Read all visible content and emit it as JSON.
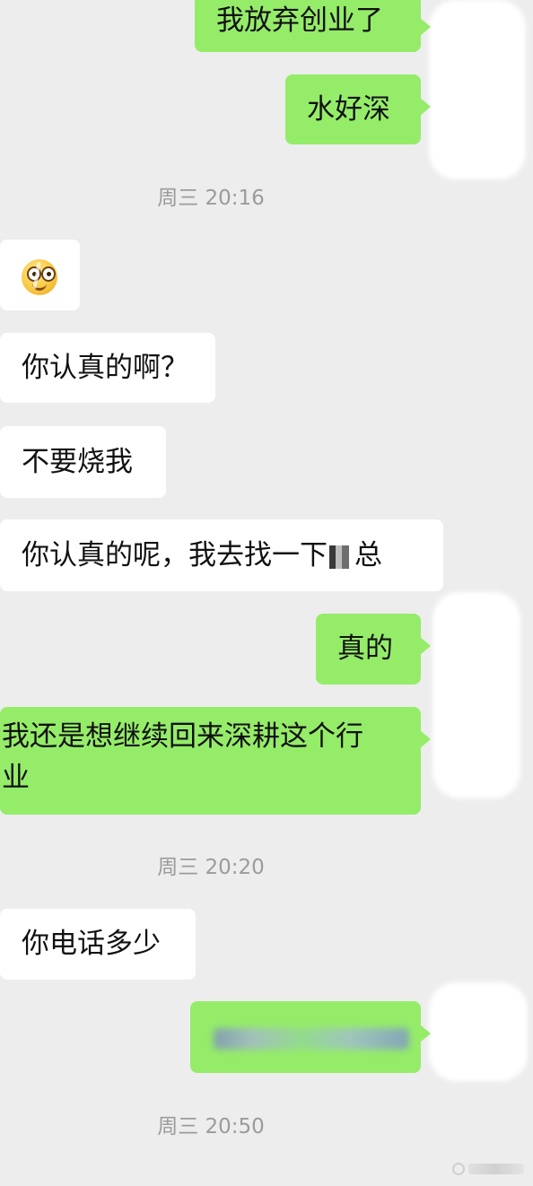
{
  "messages": [
    {
      "side": "out",
      "text": "我放弃创业了"
    },
    {
      "side": "out",
      "text": "水好深"
    },
    {
      "type": "time",
      "text": "周三 20:16"
    },
    {
      "side": "in",
      "type": "emoji",
      "icon": "grinning-face-icon"
    },
    {
      "side": "in",
      "text": "你认真的啊？"
    },
    {
      "side": "in",
      "text": "不要烧我"
    },
    {
      "side": "in",
      "text_before": "你认真的呢，我去找一下",
      "text_after": "总"
    },
    {
      "side": "out",
      "text": "真的"
    },
    {
      "side": "out",
      "text_line1": "我还是想继续回来深耕这个行",
      "text_line2": "业"
    },
    {
      "type": "time",
      "text": "周三 20:20"
    },
    {
      "side": "in",
      "text": "你电话多少"
    },
    {
      "side": "out",
      "text": "",
      "redacted": true
    },
    {
      "type": "time",
      "text": "周三 20:50"
    }
  ],
  "colors": {
    "background": "#ededed",
    "incoming_bubble": "#ffffff",
    "outgoing_bubble": "#95ec69",
    "timestamp": "#9b9b9b"
  }
}
